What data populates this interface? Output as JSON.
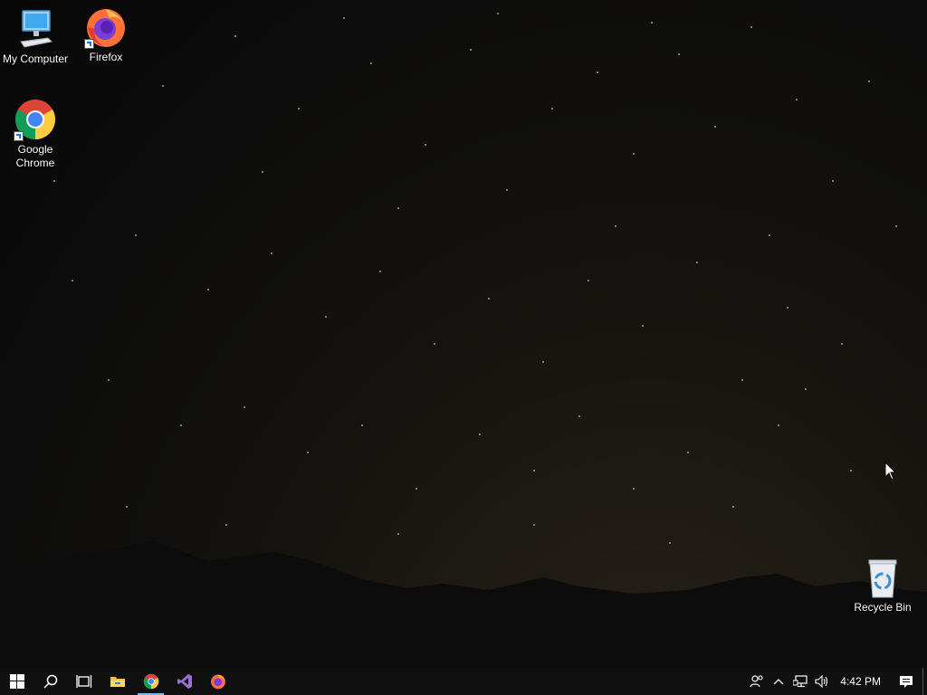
{
  "desktop": {
    "icons": [
      {
        "label": "My Computer",
        "icon": "computer-icon"
      },
      {
        "label": "Firefox",
        "icon": "firefox-icon"
      },
      {
        "label": "Google Chrome",
        "icon": "chrome-icon"
      },
      {
        "label": "Recycle Bin",
        "icon": "recycle-bin-icon"
      }
    ]
  },
  "taskbar": {
    "start": "windows-start-icon",
    "search": "search-icon",
    "task_view": "task-view-icon",
    "pinned": [
      {
        "name": "File Explorer",
        "icon": "folder-icon"
      },
      {
        "name": "Google Chrome",
        "icon": "chrome-icon",
        "active": true
      },
      {
        "name": "Visual Studio",
        "icon": "visual-studio-icon"
      },
      {
        "name": "Firefox",
        "icon": "firefox-icon"
      }
    ],
    "tray": {
      "icons": [
        "people-icon",
        "chevron-up-icon",
        "network-icon",
        "volume-icon"
      ],
      "clock": "4:42 PM",
      "notifications": "action-center-icon"
    }
  },
  "colors": {
    "taskbar_bg": "#101010",
    "active_indicator": "#76b9ed",
    "text": "#ffffff"
  }
}
